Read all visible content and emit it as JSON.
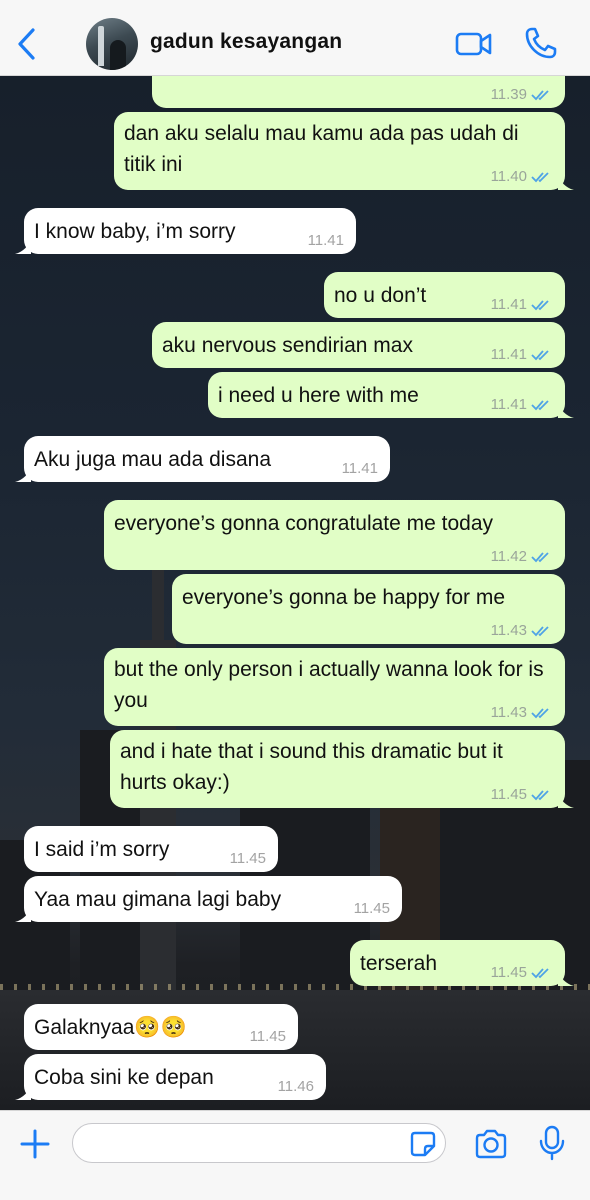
{
  "header": {
    "contact_name": "gadun kesayangan",
    "icons": [
      "chevron-left-icon",
      "video-camera-icon",
      "phone-icon"
    ]
  },
  "messages": [
    {
      "dir": "out",
      "text": "",
      "time": "11.39",
      "read": true
    },
    {
      "dir": "out",
      "text": "dan aku selalu mau kamu ada pas udah di titik ini",
      "time": "11.40",
      "read": true
    },
    {
      "dir": "in",
      "text": "I know baby, i’m sorry",
      "time": "11.41"
    },
    {
      "dir": "out",
      "text": "no u don’t",
      "time": "11.41",
      "read": true
    },
    {
      "dir": "out",
      "text": "aku nervous sendirian max",
      "time": "11.41",
      "read": true
    },
    {
      "dir": "out",
      "text": "i need u here with me",
      "time": "11.41",
      "read": true
    },
    {
      "dir": "in",
      "text": "Aku juga mau ada disana",
      "time": "11.41"
    },
    {
      "dir": "out",
      "text": "everyone’s gonna congratulate me today",
      "time": "11.42",
      "read": true
    },
    {
      "dir": "out",
      "text": "everyone’s gonna be happy for me",
      "time": "11.43",
      "read": true
    },
    {
      "dir": "out",
      "text": "but the only person i actually wanna look for is you",
      "time": "11.43",
      "read": true
    },
    {
      "dir": "out",
      "text": "and i hate that i sound this dramatic but it hurts okay:)",
      "time": "11.45",
      "read": true
    },
    {
      "dir": "in",
      "text": "I said i’m sorry",
      "time": "11.45"
    },
    {
      "dir": "in",
      "text": "Yaa mau gimana lagi baby",
      "time": "11.45"
    },
    {
      "dir": "out",
      "text": "terserah",
      "time": "11.45",
      "read": true
    },
    {
      "dir": "in",
      "text": "Galaknyaa🥺🥺",
      "time": "11.45"
    },
    {
      "dir": "in",
      "text": "Coba sini ke depan",
      "time": "11.46"
    }
  ],
  "input": {
    "value": "",
    "placeholder": ""
  },
  "colors": {
    "accent": "#1c7cf4",
    "outgoing_bubble": "#e1fec6",
    "incoming_bubble": "#ffffff",
    "read_ticks": "#4fa3e6"
  }
}
